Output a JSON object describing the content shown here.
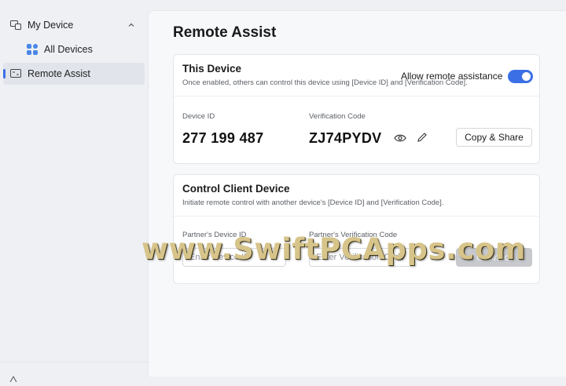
{
  "sidebar": {
    "group_label": "My Device",
    "sub_item_label": "All Devices",
    "active_item_label": "Remote Assist",
    "icons": [
      "devices-icon",
      "grid-icon",
      "remote-assist-icon",
      "chevron-up-icon"
    ]
  },
  "main": {
    "title": "Remote Assist",
    "this_device": {
      "title": "This Device",
      "description": "Once enabled, others can control this device using [Device ID] and [Verification Code].",
      "toggle_label": "Allow remote assistance",
      "toggle_on": true,
      "device_id_label": "Device ID",
      "device_id_value": "277 199 487",
      "verification_label": "Verification Code",
      "verification_value": "ZJ74PYDV",
      "copy_share_label": "Copy & Share"
    },
    "control_client": {
      "title": "Control Client Device",
      "description": "Initiate remote control with another device's [Device ID] and [Verification Code].",
      "partner_id_label": "Partner's Device ID",
      "partner_id_placeholder": "Enter Device ID",
      "partner_code_label": "Partner's Verification Code",
      "partner_code_placeholder": "Enter Verification Code",
      "connect_label": "Connect"
    }
  },
  "colors": {
    "accent": "#3b6fe6",
    "sidebar_bg": "#eef0f4",
    "card_bg": "#ffffff"
  },
  "watermark": "www.SwiftPCApps.com"
}
